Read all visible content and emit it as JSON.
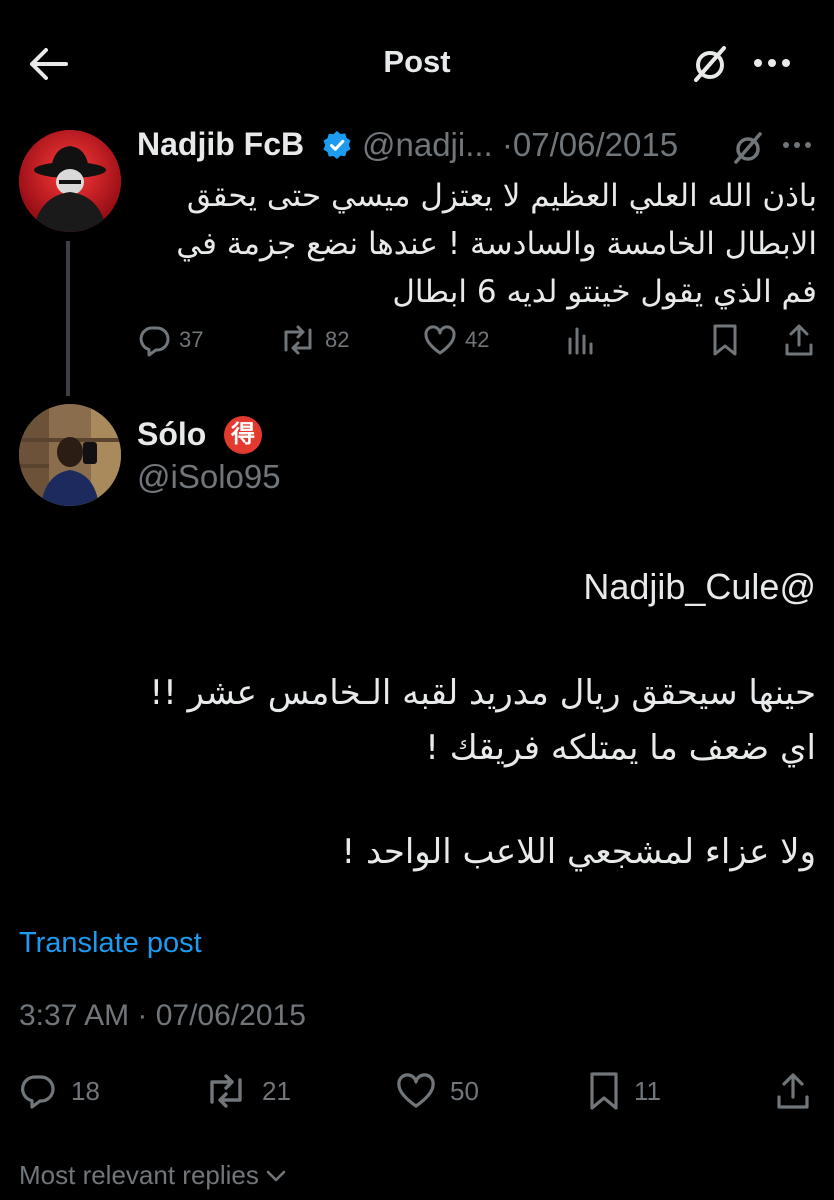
{
  "header": {
    "title": "Post"
  },
  "parent_post": {
    "name": "Nadjib FcB",
    "handle": "@nadji...",
    "date_sep": "·",
    "date": "07/06/2015",
    "text_lines": [
      "باذن الله العلي العظيم لا يعتزل ميسي حتى يحقق",
      "الابطال الخامسة والسادسة ! عندها نضع جزمة في",
      "فم الذي يقول خينتو لديه 6 ابطال"
    ],
    "replies": "37",
    "reposts": "82",
    "likes": "42"
  },
  "post": {
    "name": "Sólo",
    "badge": "得",
    "handle": "@iSolo95",
    "mention": "Nadjib_Cule@",
    "lines": [
      "حينها سيحقق ريال مدريد لقبه الـخامس عشر !!",
      "اي ضعف ما يمتلكه فريقك !",
      "ولا عزاء لمشجعي اللاعب الواحد !"
    ],
    "translate_label": "Translate post",
    "timestamp": "3:37 AM · 07/06/2015",
    "replies": "18",
    "reposts": "21",
    "likes": "50",
    "bookmarks": "11"
  },
  "replies_sort": {
    "label": "Most relevant replies"
  },
  "colors": {
    "background": "#000000",
    "text": "#e7e9ea",
    "muted": "#71767b",
    "accent": "#1d9bf0"
  },
  "icons": [
    "back-arrow-icon",
    "grok-icon",
    "more-icon",
    "verified-icon",
    "reply-icon",
    "repost-icon",
    "like-icon",
    "views-icon",
    "bookmark-icon",
    "share-icon",
    "chevron-down-icon"
  ]
}
